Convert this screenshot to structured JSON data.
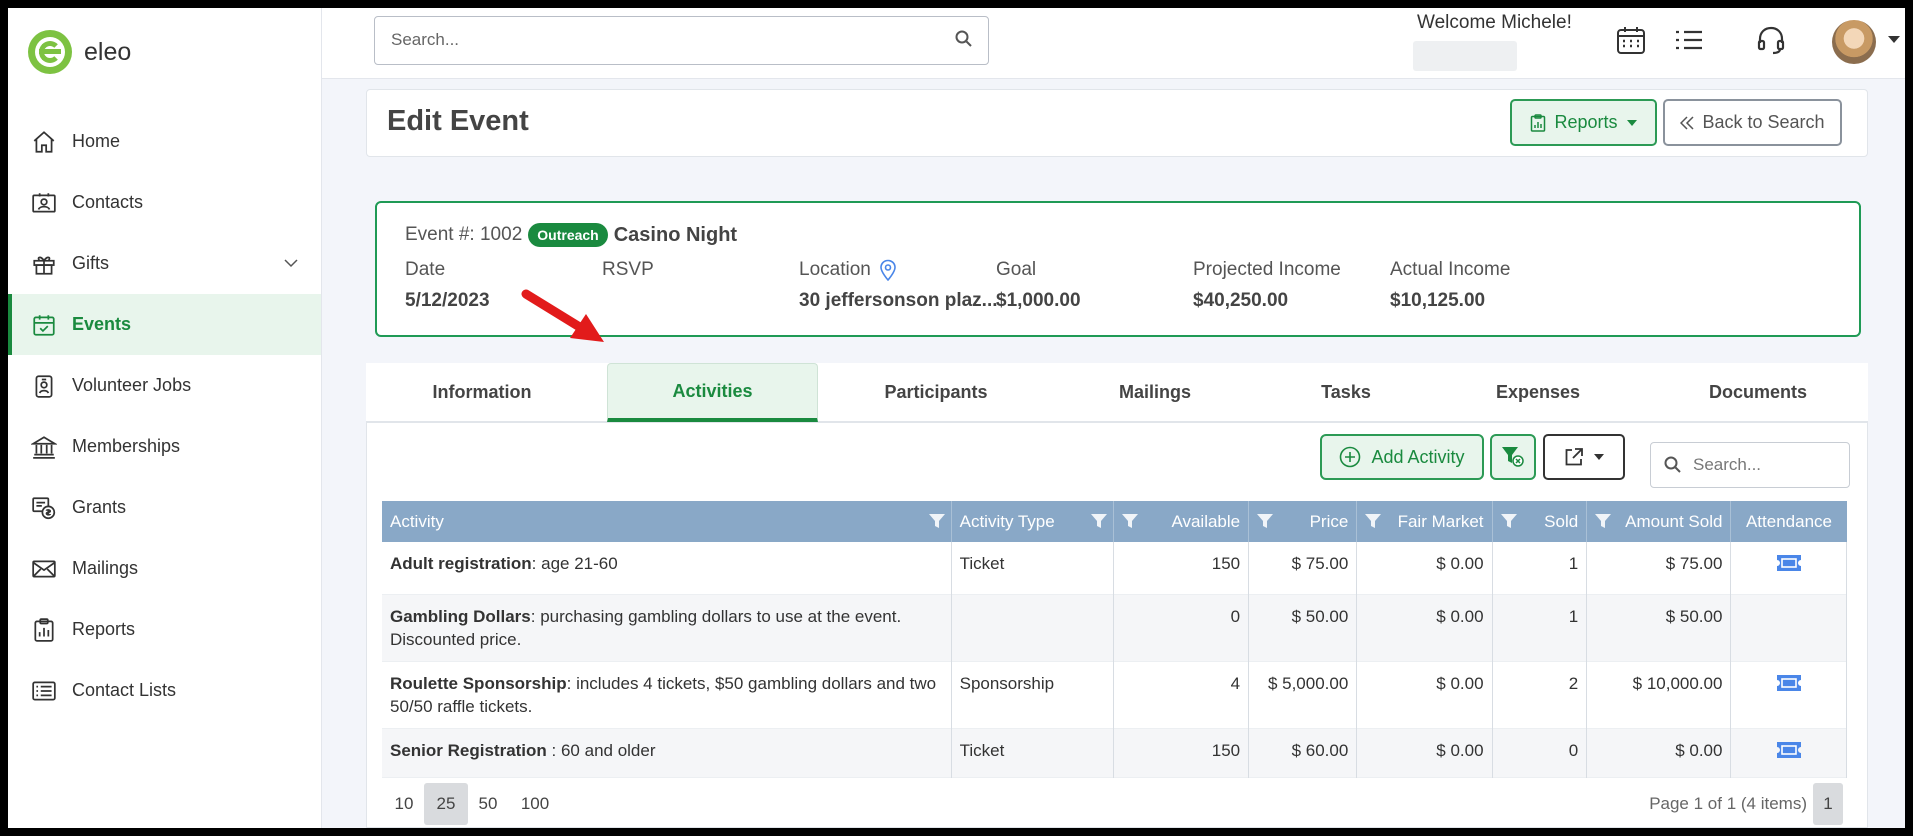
{
  "app": {
    "name": "eleo"
  },
  "colors": {
    "brand_green": "#1a8a3f",
    "logo_green": "#7dc242",
    "header_blue": "#89a8c7",
    "ticket_blue": "#4a86e8"
  },
  "sidebar": {
    "items": [
      {
        "label": "Home",
        "icon": "home-icon"
      },
      {
        "label": "Contacts",
        "icon": "contact-card-icon"
      },
      {
        "label": "Gifts",
        "icon": "gift-icon"
      },
      {
        "label": "Events",
        "icon": "calendar-check-icon"
      },
      {
        "label": "Volunteer Jobs",
        "icon": "badge-icon"
      },
      {
        "label": "Memberships",
        "icon": "institution-icon"
      },
      {
        "label": "Grants",
        "icon": "grant-icon"
      },
      {
        "label": "Mailings",
        "icon": "envelope-icon"
      },
      {
        "label": "Reports",
        "icon": "clipboard-chart-icon"
      },
      {
        "label": "Contact Lists",
        "icon": "list-icon"
      }
    ]
  },
  "topbar": {
    "search_placeholder": "Search...",
    "welcome": "Welcome Michele!"
  },
  "header": {
    "title": "Edit Event",
    "reports_label": "Reports",
    "back_label": "Back to Search"
  },
  "event": {
    "number_label": "Event #: 1002",
    "type_badge": "Outreach",
    "name": "Casino Night",
    "fields": [
      {
        "label": "Date",
        "value": "5/12/2023"
      },
      {
        "label": "RSVP",
        "value": ""
      },
      {
        "label": "Location",
        "value": "30 jeffersonson plaz..."
      },
      {
        "label": "Goal",
        "value": "$1,000.00"
      },
      {
        "label": "Projected Income",
        "value": "$40,250.00"
      },
      {
        "label": "Actual Income",
        "value": "$10,125.00"
      }
    ]
  },
  "tabs": [
    "Information",
    "Activities",
    "Participants",
    "Mailings",
    "Tasks",
    "Expenses",
    "Documents"
  ],
  "toolbar": {
    "add_label": "Add Activity",
    "search_placeholder": "Search..."
  },
  "grid": {
    "columns": [
      "Activity",
      "Activity Type",
      "Available",
      "Price",
      "Fair Market",
      "Sold",
      "Amount Sold",
      "Attendance"
    ],
    "rows": [
      {
        "name": "Adult registration",
        "desc": ": age 21-60",
        "type": "Ticket",
        "available": "150",
        "price": "$ 75.00",
        "fair": "$ 0.00",
        "sold": "1",
        "amount": "$ 75.00",
        "attendance": true
      },
      {
        "name": "Gambling Dollars",
        "desc": ": purchasing gambling dollars to use at the event.  Discounted price.",
        "type": "",
        "available": "0",
        "price": "$ 50.00",
        "fair": "$ 0.00",
        "sold": "1",
        "amount": "$ 50.00",
        "attendance": false
      },
      {
        "name": "Roulette Sponsorship",
        "desc": ": includes 4 tickets, $50 gambling dollars and two 50/50 raffle tickets.",
        "type": "Sponsorship",
        "available": "4",
        "price": "$ 5,000.00",
        "fair": "$ 0.00",
        "sold": "2",
        "amount": "$ 10,000.00",
        "attendance": true
      },
      {
        "name": "Senior Registration",
        "desc": " : 60 and older",
        "type": "Ticket",
        "available": "150",
        "price": "$ 60.00",
        "fair": "$ 0.00",
        "sold": "0",
        "amount": "$ 0.00",
        "attendance": true
      }
    ]
  },
  "pager": {
    "sizes": [
      "10",
      "25",
      "50",
      "100"
    ],
    "selected_size": "25",
    "info": "Page 1 of 1 (4 items)",
    "current_page": "1"
  }
}
